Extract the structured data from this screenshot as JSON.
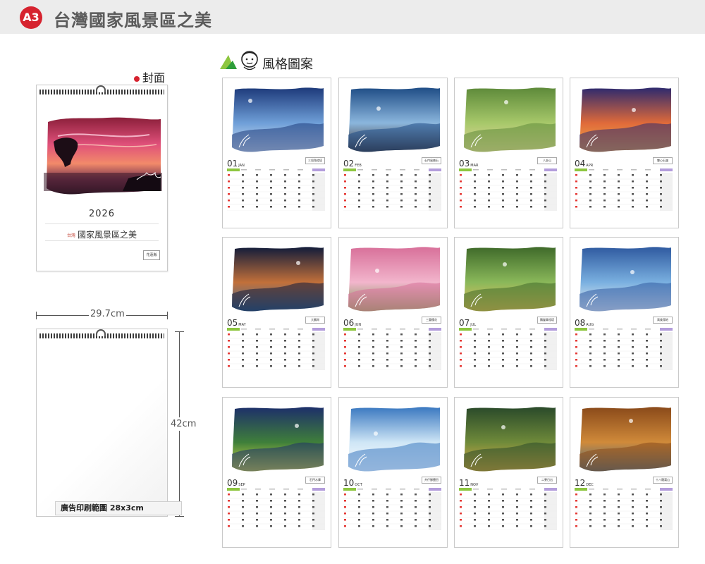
{
  "header": {
    "badge": "A3",
    "title": "台灣國家風景區之美"
  },
  "style_section": {
    "label": "風格圖案"
  },
  "cover": {
    "label": "封面",
    "year": "2026",
    "calendar_name": "國家風景區之美",
    "calendar_name_prefix": "台灣",
    "stamp": "花蓮縣"
  },
  "dimensions": {
    "width_label": "29.7cm",
    "height_label": "42cm"
  },
  "back_page": {
    "ad_area_label": "廣告印刷範圍 28x3cm"
  },
  "months": [
    {
      "num": "01",
      "en": "JAN",
      "place": "三貂角燈塔"
    },
    {
      "num": "02",
      "en": "FEB",
      "place": "石門風稜石"
    },
    {
      "num": "03",
      "en": "MAR",
      "place": "八卦山"
    },
    {
      "num": "04",
      "en": "APR",
      "place": "雙心石滬"
    },
    {
      "num": "05",
      "en": "MAY",
      "place": "大鵬灣"
    },
    {
      "num": "06",
      "en": "JUN",
      "place": "三重櫻花"
    },
    {
      "num": "07",
      "en": "JUL",
      "place": "鵝鑾鼻燈塔"
    },
    {
      "num": "08",
      "en": "AUG",
      "place": "高美濕地"
    },
    {
      "num": "09",
      "en": "SEP",
      "place": "石門水庫"
    },
    {
      "num": "10",
      "en": "OCT",
      "place": "井仔腳鹽田"
    },
    {
      "num": "11",
      "en": "NOV",
      "place": "二寮日出"
    },
    {
      "num": "12",
      "en": "DEC",
      "place": "十八羅漢山"
    }
  ],
  "colors": {
    "accent": "#d6232f",
    "header_bg": "#ececec",
    "title_text": "#5b5b5b",
    "calendar_green": "#8dc63f",
    "calendar_purple": "#b39ddb",
    "sunday_red": "#e53935"
  },
  "icons": [
    "triangle-logo-icon",
    "face-doodle-icon",
    "red-dot-icon"
  ]
}
